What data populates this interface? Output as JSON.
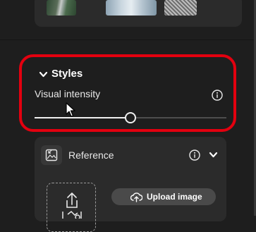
{
  "styles": {
    "title": "Styles",
    "visual_intensity": {
      "label": "Visual intensity",
      "value_fraction": 0.5
    }
  },
  "reference": {
    "title": "Reference",
    "upload_button_label": "Upload image"
  },
  "icons": {
    "styles_chevron": "chevron-down-icon",
    "styles_info": "info-icon",
    "reference": "image-reference-icon",
    "reference_info": "info-icon",
    "reference_chevron": "chevron-down-icon",
    "dropzone": "upload-image-icon",
    "upload_button": "cloud-upload-icon",
    "cursor": "mouse-pointer-icon"
  },
  "colors": {
    "highlight_outline": "#e3000f",
    "panel_background": "#1e1e1e",
    "card_background": "#2b2b2b",
    "slider_fill": "#f0f0f0"
  }
}
